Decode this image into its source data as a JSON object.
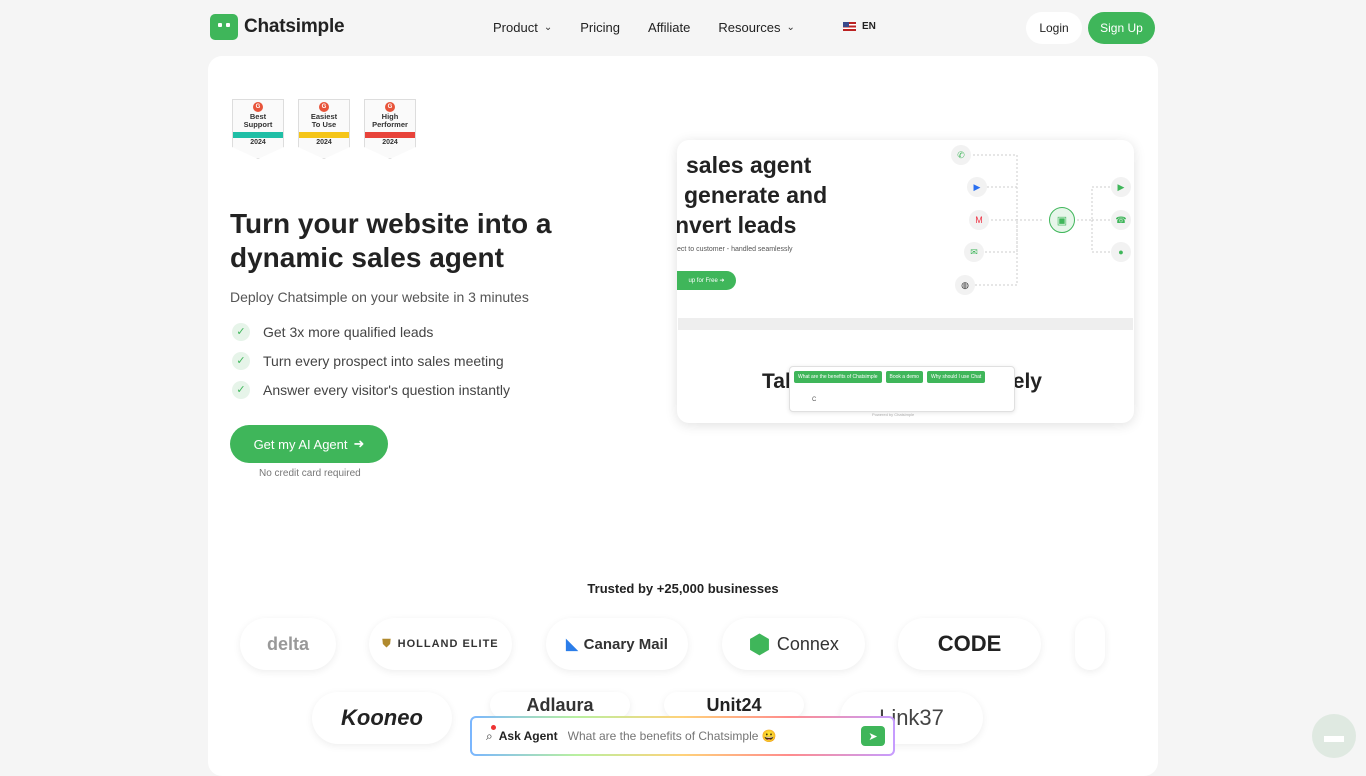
{
  "nav": {
    "brand": "Chatsimple",
    "links": [
      {
        "label": "Product",
        "has_dropdown": true
      },
      {
        "label": "Pricing",
        "has_dropdown": false
      },
      {
        "label": "Affiliate",
        "has_dropdown": false
      },
      {
        "label": "Resources",
        "has_dropdown": true
      }
    ],
    "language": "EN",
    "login": "Login",
    "signup": "Sign Up"
  },
  "badges": [
    {
      "line1": "Best",
      "line2": "Support",
      "year": "2024",
      "stripe_color": "#1fbfa6"
    },
    {
      "line1": "Easiest",
      "line2": "To Use",
      "year": "2024",
      "stripe_color": "#f5c518"
    },
    {
      "line1": "High",
      "line2": "Performer",
      "year": "2024",
      "stripe_color": "#e8433a"
    }
  ],
  "hero": {
    "title": "Turn your website into a dynamic sales agent",
    "subtitle": "Deploy Chatsimple on your website in 3 minutes",
    "bullets": [
      "Get 3x more qualified leads",
      "Turn every prospect into sales meeting",
      "Answer every visitor's question instantly"
    ],
    "cta": "Get my AI Agent",
    "note": "No credit card required"
  },
  "demo": {
    "headline_1": "sales agent",
    "headline_2": "generate and",
    "headline_3": "nvert leads",
    "small": "ect to customer - handled seamlessly",
    "button": "up for Free",
    "big_left": "Tal",
    "big_right": "ely",
    "chips": [
      "What are the benefits of Chatsimple",
      "Book a demo",
      "Why should I use Chat"
    ],
    "input": "C",
    "powered": "Powered by Chatsimple"
  },
  "trusted": "Trusted by +25,000 businesses",
  "logos_row1": [
    "delta",
    "HOLLAND ELITE",
    "Canary Mail",
    "Connex",
    "CODE"
  ],
  "logos_row2": [
    "Kooneo",
    "Adlaura",
    "Unit24",
    "Link37"
  ],
  "ask": {
    "label": "Ask Agent",
    "placeholder": "What are the benefits of Chatsimple 😀"
  },
  "colors": {
    "accent": "#3fb65a"
  }
}
